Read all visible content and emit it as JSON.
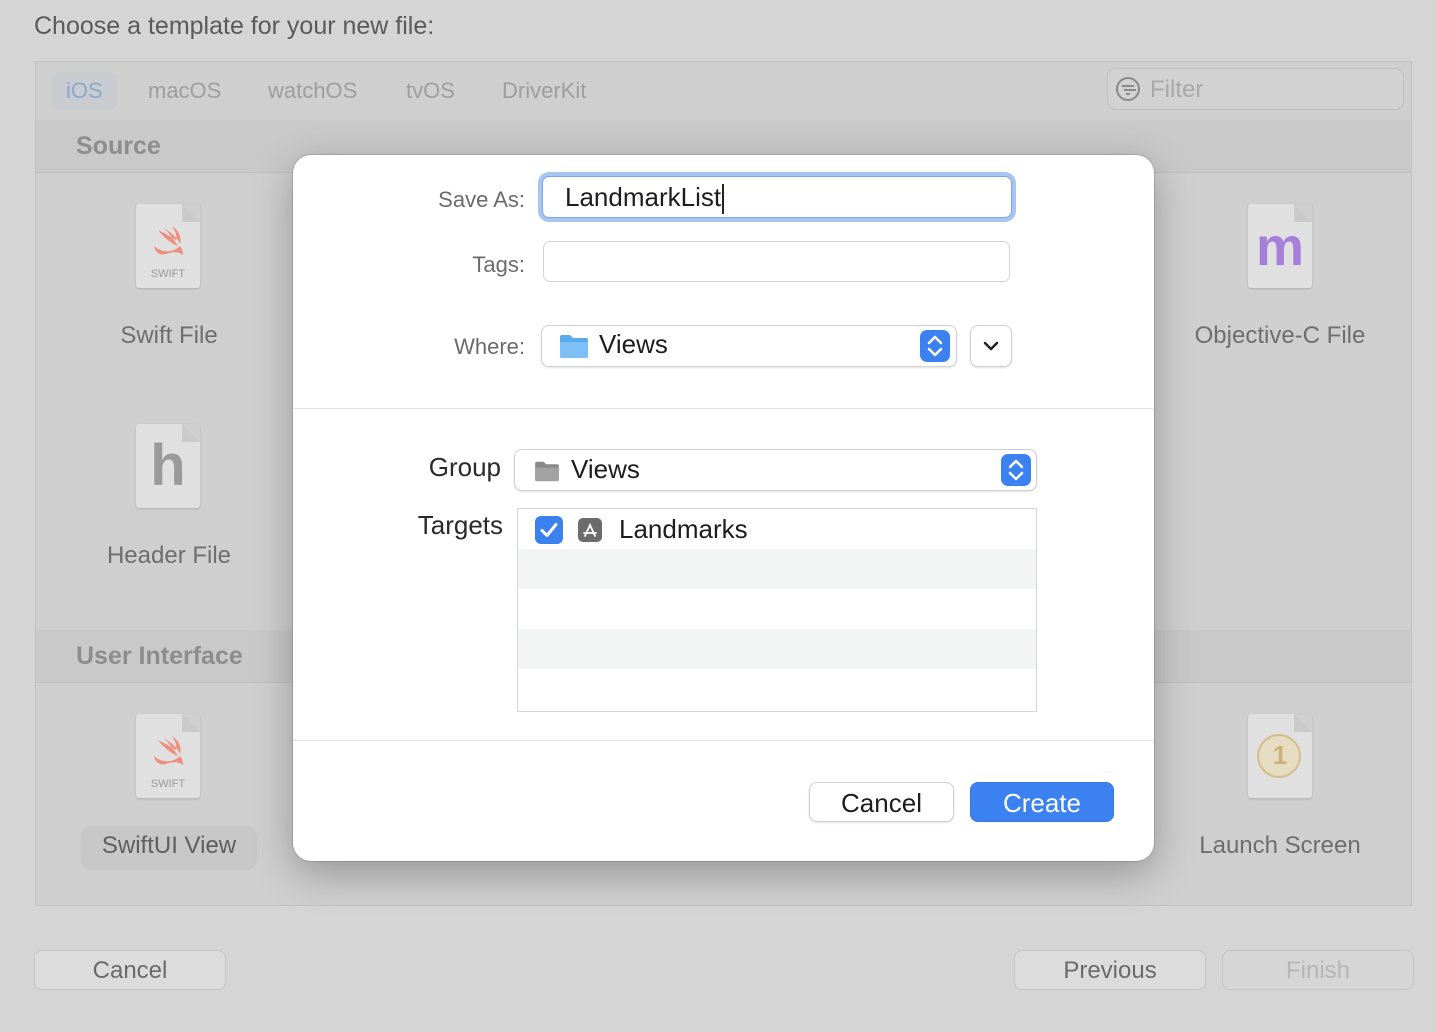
{
  "background": {
    "heading": "Choose a template for your new file:",
    "platform_tabs": [
      "iOS",
      "macOS",
      "watchOS",
      "tvOS",
      "DriverKit"
    ],
    "selected_tab": "iOS",
    "filter_placeholder": "Filter",
    "sections": [
      {
        "title": "Source",
        "items": [
          {
            "label": "Swift File",
            "icon": "swift-file-icon",
            "badge": "SWIFT"
          },
          {
            "label": "Objective-C File",
            "icon": "objc-file-icon",
            "letter": "m"
          },
          {
            "label": "Header File",
            "icon": "header-file-icon",
            "letter": "h"
          }
        ]
      },
      {
        "title": "User Interface",
        "items": [
          {
            "label": "SwiftUI View",
            "icon": "swiftui-file-icon",
            "badge": "SWIFT"
          },
          {
            "label": "Launch Screen",
            "icon": "launch-screen-icon",
            "letter": "1"
          }
        ]
      }
    ],
    "buttons": {
      "cancel": "Cancel",
      "previous": "Previous",
      "finish": "Finish"
    }
  },
  "sheet": {
    "save_as_label": "Save As:",
    "save_as_value": "LandmarkList",
    "tags_label": "Tags:",
    "tags_value": "",
    "where_label": "Where:",
    "where_value": "Views",
    "group_label": "Group",
    "group_value": "Views",
    "targets_label": "Targets",
    "targets": [
      {
        "name": "Landmarks",
        "checked": true
      }
    ],
    "cancel_label": "Cancel",
    "create_label": "Create"
  },
  "colors": {
    "accent": "#3b82f0",
    "swift_orange": "#f05138",
    "objc_purple": "#8e5bd1"
  }
}
